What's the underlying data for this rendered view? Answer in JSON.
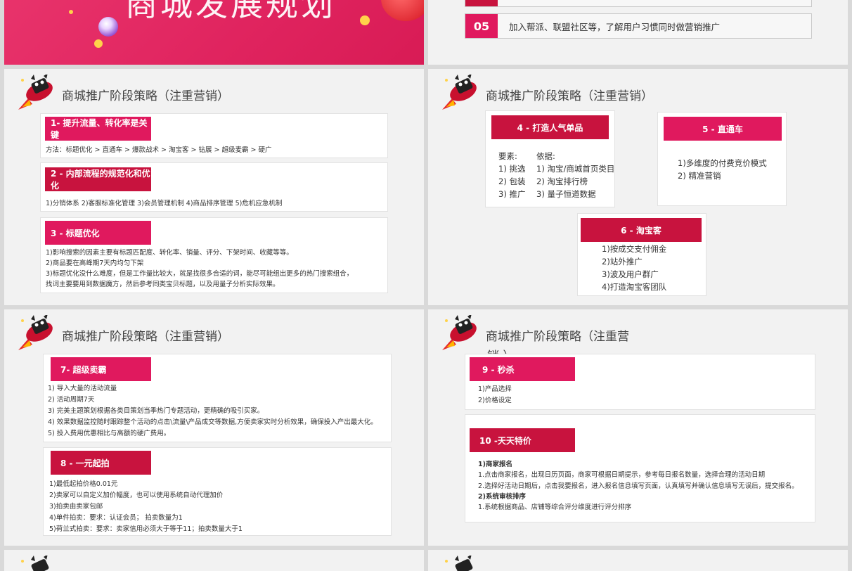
{
  "top_left": {
    "title": "商城发展规划"
  },
  "top_right": {
    "row_number": "05",
    "row_text": "加入帮派、联盟社区等，了解用户习惯同时做营销推广"
  },
  "section_title": "商城推广阶段策略（注重营销）",
  "section_title_split": {
    "line1": "商城推广阶段策略（注重营",
    "line2": "销                               ）"
  },
  "slide1": {
    "card1": {
      "label": "1- 提升流量、转化率是关键",
      "text": "方法：标题优化 > 直通车 > 爆款战术 > 淘宝客 > 钻展 > 超级麦霸 > 硬广"
    },
    "card2": {
      "label": "2 - 内部流程的规范化和优化",
      "text": "1)分销体系  2)客服标准化管理  3)会员管理机制  4)商品排序管理  5)危机应急机制"
    },
    "card3": {
      "label": "3 - 标题优化",
      "lines": [
        "1)影响搜索的因素主要有标题匹配度、转化率、销量、评分、下架时间、收藏等等。",
        "2)商品要在高峰期7天内均匀下架",
        "3)标题优化没什么难度，但是工作量比较大，就是找很多合适的词，能尽可能组出更多的热门搜索组合，",
        "找词主要要用到数据魔方，然后参考同类宝贝标题，以及用量子分析实际效果。"
      ]
    }
  },
  "slide2": {
    "card4": {
      "label": "4 - 打造人气单品",
      "col1": [
        "要素:",
        "1) 挑选",
        "2) 包装",
        "3) 推广"
      ],
      "col2": [
        "依据:",
        "1) 淘宝/商城首页类目",
        "2) 淘宝排行榜",
        "3) 量子恒道数据"
      ]
    },
    "card5": {
      "label": "5 - 直通车",
      "lines": [
        "1)多维度的付费竞价模式",
        "2)  精准营销"
      ]
    },
    "card6": {
      "label": "6 - 淘宝客",
      "lines": [
        "1)按成交支付佣金",
        "2)站外推广",
        "3)波及用户群广",
        "4)打造淘宝客团队"
      ]
    }
  },
  "slide3": {
    "card7": {
      "label": "7- 超级卖霸",
      "lines": [
        "1)    导入大量的活动流量",
        "2)    活动周期7天",
        "3)    完美主题策划根据各类目策划当季热门专题活动，更精确的吸引买家。",
        "4)    效果数据监控随时跟踪整个活动的点击\\流量\\产品成交等数据,方便卖家实时分析效果，确保投入产出最大化。",
        "5)    投入费用优惠相比与高额的硬广费用。"
      ]
    },
    "card8": {
      "label": "8 - 一元起拍",
      "lines": [
        "1)最低起拍价格0.01元",
        "2)卖家可以自定义加价幅度，也可以使用系统自动代理加价",
        "3)拍卖由卖家包邮",
        "4)单件拍卖：要求：认证会员；  拍卖数量为1",
        "5)荷兰式拍卖：要求：卖家信用必须大于等于11；拍卖数量大于1"
      ]
    }
  },
  "slide4": {
    "card9": {
      "label": "9 - 秒杀",
      "lines": [
        "1)产品选择",
        "2)价格设定"
      ]
    },
    "card10": {
      "label": "10 -天天特价",
      "lines": [
        {
          "text": "1)商家报名",
          "bold": true
        },
        {
          "text": "1.点击商家报名，出现日历页面，商家可根据日期提示，参考每日报名数量，选择合理的活动日期",
          "bold": false
        },
        {
          "text": "2.选择好活动日期后，点击我要报名，进入报名信息填写页面，认真填写并确认信息填写无误后，提交报名。",
          "bold": false
        },
        {
          "text": "2)系统审核排序",
          "bold": true
        },
        {
          "text": "1.系统根据商品、店铺等综合评分维度进行评分排序",
          "bold": false
        }
      ]
    }
  },
  "colors": {
    "pink": "#e0195e",
    "crimson": "#c8133e",
    "slide_bg": "#f2f2f2"
  },
  "icons": {
    "logo": "tmall-cat-rocket-icon"
  }
}
